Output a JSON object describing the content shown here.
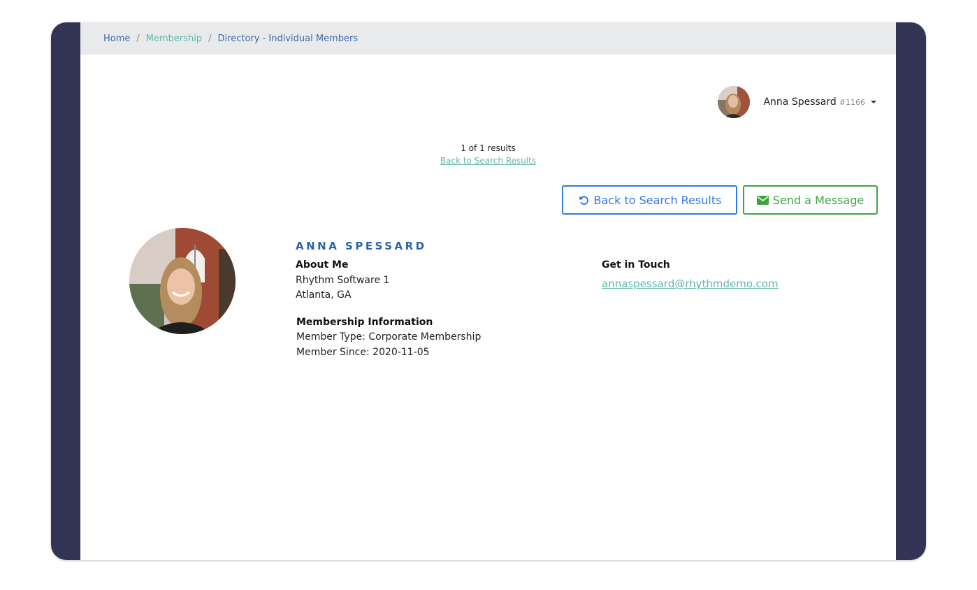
{
  "breadcrumb": {
    "home": "Home",
    "membership": "Membership",
    "current": "Directory - Individual Members",
    "separator": "/"
  },
  "user_menu": {
    "name": "Anna Spessard",
    "id": "#1166"
  },
  "results": {
    "count_text": "1 of 1 results",
    "back_link": "Back to Search Results"
  },
  "buttons": {
    "back_label": "Back to Search Results",
    "send_label": "Send a Message"
  },
  "profile": {
    "name": "ANNA SPESSARD",
    "about_title": "About Me",
    "company": "Rhythm Software 1",
    "location": "Atlanta, GA",
    "membership_title": "Membership Information",
    "member_type": "Member Type: Corporate Membership",
    "member_since": "Member Since: 2020-11-05",
    "contact_title": "Get in Touch",
    "email": "annaspessard@rhythmdemo.com"
  },
  "colors": {
    "frame": "#333455",
    "breadcrumb_bg": "#e9eaec",
    "primary_blue": "#2f7ae5",
    "success_green": "#3fa63f",
    "teal_link": "#62b6ac",
    "name_blue": "#2b63ad"
  },
  "icons": {
    "back": "undo-icon",
    "send": "envelope-icon",
    "menu": "caret-down-icon"
  }
}
